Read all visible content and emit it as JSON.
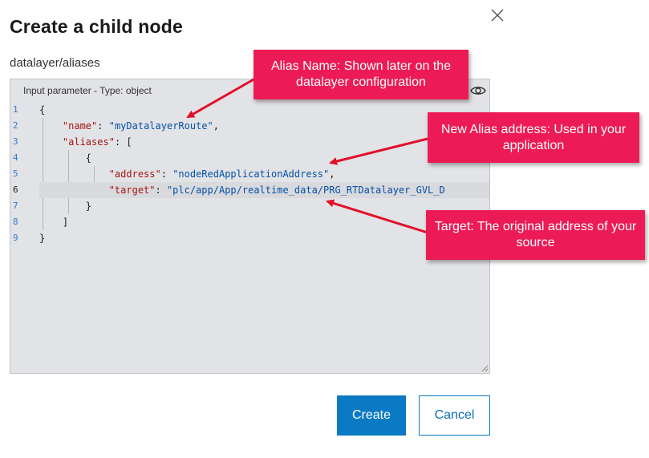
{
  "dialog": {
    "title": "Create a child node",
    "path": "datalayer/aliases",
    "close_icon": "close-icon"
  },
  "editor": {
    "header": "Input parameter - Type: object",
    "eye_icon": "eye-icon",
    "line_numbers": [
      "1",
      "2",
      "3",
      "4",
      "5",
      "6",
      "7",
      "8",
      "9"
    ],
    "code": {
      "l1_open": "{",
      "name_key": "\"name\"",
      "name_sep": ": ",
      "name_value": "\"myDatalayerRoute\"",
      "name_end": ",",
      "aliases_key": "\"aliases\"",
      "aliases_sep": ": [",
      "l4_open": "{",
      "address_key": "\"address\"",
      "address_sep": ": ",
      "address_value": "\"nodeRedApplicationAddress\"",
      "address_end": ",",
      "target_key": "\"target\"",
      "target_sep": ": ",
      "target_value": "\"plc/app/App/realtime_data/PRG_RTDatalayer_GVL_D",
      "l7_close": "}",
      "l8_close": "]",
      "l9_close": "}"
    }
  },
  "buttons": {
    "create": "Create",
    "cancel": "Cancel"
  },
  "callouts": {
    "alias_name": "Alias Name: Shown later on the datalayer configuration",
    "alias_address": "New Alias address: Used in your application",
    "target": "Target: The original address of your source"
  },
  "colors": {
    "primary": "#0b7ac4",
    "callout": "#ed1b55",
    "editor_bg": "#e2e3e6"
  }
}
